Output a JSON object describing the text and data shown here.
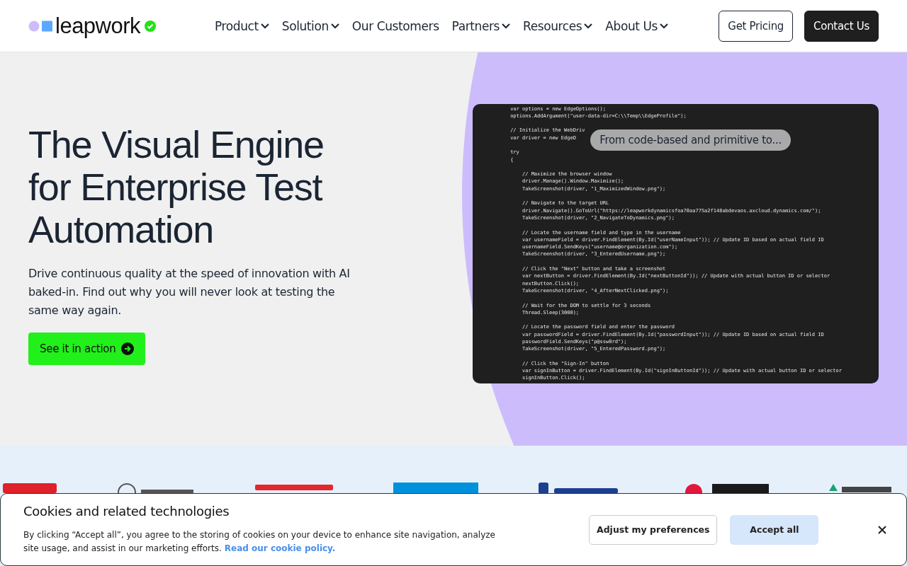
{
  "header": {
    "brand": "leapwork",
    "nav": [
      {
        "label": "Product",
        "has_menu": true
      },
      {
        "label": "Solution",
        "has_menu": true
      },
      {
        "label": "Our Customers",
        "has_menu": false
      },
      {
        "label": "Partners",
        "has_menu": true
      },
      {
        "label": "Resources",
        "has_menu": true
      },
      {
        "label": "About Us",
        "has_menu": true
      }
    ],
    "buttons": [
      {
        "label": "Get Pricing",
        "kind": "outline"
      },
      {
        "label": "Contact Us",
        "kind": "solid"
      }
    ]
  },
  "hero": {
    "title": "The Visual Engine for Enterprise Test Automation",
    "text": "Drive continuous quality at the speed of innovation with AI baked-in. Find out why you will never look at testing the same way again.",
    "cta": "See it in action",
    "code_caption": "From code-based and primitive to...",
    "code_blocks": [
      [
        "var options = new EdgeOptions();",
        "options.AddArgument(\"user-data-dir=C:\\\\Temp\\\\EdgeProfile\");"
      ],
      [
        "// Initialize the WebDriv",
        "var driver = new EdgeD"
      ],
      [
        "try",
        "{"
      ],
      [
        "    // Maximize the browser window",
        "    driver.Manage().Window.Maximize();",
        "    TakeScreenshot(driver, \"1_MaximizedWindow.png\");"
      ],
      [
        "    // Navigate to the target URL",
        "    driver.Navigate().GoToUrl(\"https://leapworkdynamicsfoa70aa775a2f148abdevaos.axcloud.dynamics.com/\");",
        "    TakeScreenshot(driver, \"2_NavigateToDynamics.png\");"
      ],
      [
        "    // Locate the username field and type in the username",
        "    var usernameField = driver.FindElement(By.Id(\"userNameInput\")); // Update ID based on actual field ID",
        "    usernameField.SendKeys(\"username@organization.com\");",
        "    TakeScreenshot(driver, \"3_EnteredUsername.png\");"
      ],
      [
        "    // Click the \"Next\" button and take a screenshot",
        "    var nextButton = driver.FindElement(By.Id(\"nextButtonId\")); // Update with actual button ID or selector",
        "    nextButton.Click();",
        "    TakeScreenshot(driver, \"4_AfterNextClicked.png\");"
      ],
      [
        "    // Wait for the DOM to settle for 3 seconds",
        "    Thread.Sleep(3000);"
      ],
      [
        "    // Locate the password field and enter the password",
        "    var passwordField = driver.FindElement(By.Id(\"passwordInput\")); // Update ID based on actual field ID",
        "    passwordField.SendKeys(\"p@ssw0rd\");",
        "    TakeScreenshot(driver, \"5_EnteredPassword.png\");"
      ],
      [
        "    // Click the \"Sign-In\" button",
        "    var signInButton = driver.FindElement(By.Id(\"signInButtonId\")); // Update with actual button ID or selector",
        "    signInButton.Click();"
      ]
    ]
  },
  "customer_logos": [
    {
      "color": "#e0202a"
    },
    {
      "color": "#555555"
    },
    {
      "color": "#e4262d"
    },
    {
      "color": "#0091dc"
    },
    {
      "color": "#1d3f8f"
    },
    {
      "color": "#e3173e"
    },
    {
      "color": "#1aa36f"
    }
  ],
  "cookie_banner": {
    "title": "Cookies and related technologies",
    "text": "By clicking “Accept all”, you agree to the storing of cookies on your device to enhance site navigation, analyze site usage, and assist in our marketing efforts.",
    "link": "Read our cookie policy.",
    "buttons": [
      {
        "label": "Adjust my preferences",
        "kind": "outline"
      },
      {
        "label": "Accept all",
        "kind": "solid"
      }
    ]
  }
}
